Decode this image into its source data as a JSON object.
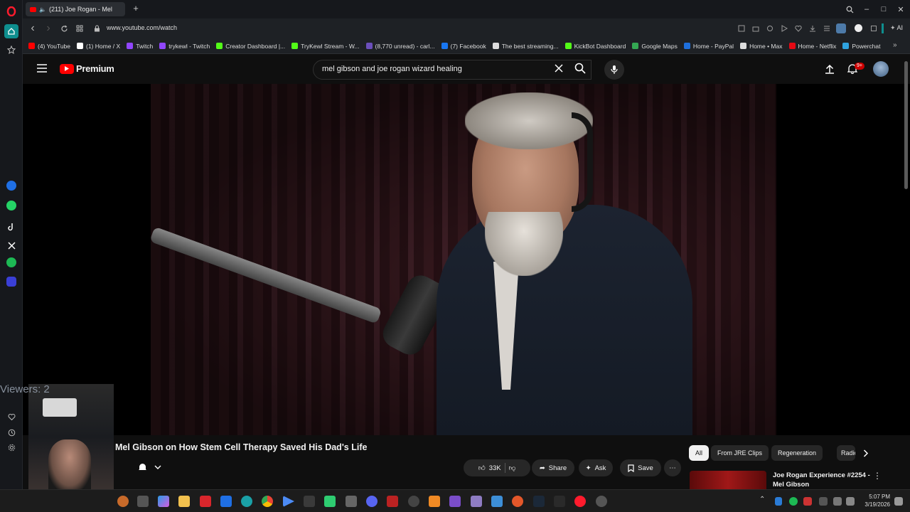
{
  "browser": {
    "tab_title": "(211) Joe Rogan - Mel",
    "url": "www.youtube.com/watch",
    "extension_label": "AI"
  },
  "bookmarks": [
    {
      "label": "(4) YouTube",
      "color": "#ff0000"
    },
    {
      "label": "(1) Home / X",
      "color": "#ffffff"
    },
    {
      "label": "Twitch",
      "color": "#9146ff"
    },
    {
      "label": "trykewl - Twitch",
      "color": "#9146ff"
    },
    {
      "label": "Creator Dashboard |...",
      "color": "#53fc18"
    },
    {
      "label": "TryKewl Stream - W...",
      "color": "#53fc18"
    },
    {
      "label": "(8,770 unread) - carl...",
      "color": "#6b4fbb"
    },
    {
      "label": "(7) Facebook",
      "color": "#1877f2"
    },
    {
      "label": "The best streaming...",
      "color": "#dddddd"
    },
    {
      "label": "KickBot Dashboard",
      "color": "#53fc18"
    },
    {
      "label": "Google Maps",
      "color": "#34a853"
    },
    {
      "label": "Home - PayPal",
      "color": "#1e6fdc"
    },
    {
      "label": "Home • Max",
      "color": "#dddddd"
    },
    {
      "label": "Home - Netflix",
      "color": "#e50914"
    },
    {
      "label": "Powerchat",
      "color": "#2fa3e0"
    }
  ],
  "youtube": {
    "brand": "Premium",
    "search_value": "mel gibson and joe rogan wizard healing",
    "notification_count": "9+"
  },
  "video": {
    "title": "Mel Gibson on How Stem Cell Therapy Saved His Dad's Life",
    "likes": "33K",
    "share_label": "Share",
    "ask_label": "Ask",
    "save_label": "Save"
  },
  "chips": [
    "All",
    "From JRE Clips",
    "Regeneration",
    "Radios"
  ],
  "up_next": {
    "title_line1": "Joe Rogan Experience #2254 -",
    "title_line2": "Mel Gibson"
  },
  "overlay": {
    "viewers": "Viewers: 2"
  },
  "taskbar": {
    "time": "5:07 PM",
    "date": "3/19/2026"
  }
}
